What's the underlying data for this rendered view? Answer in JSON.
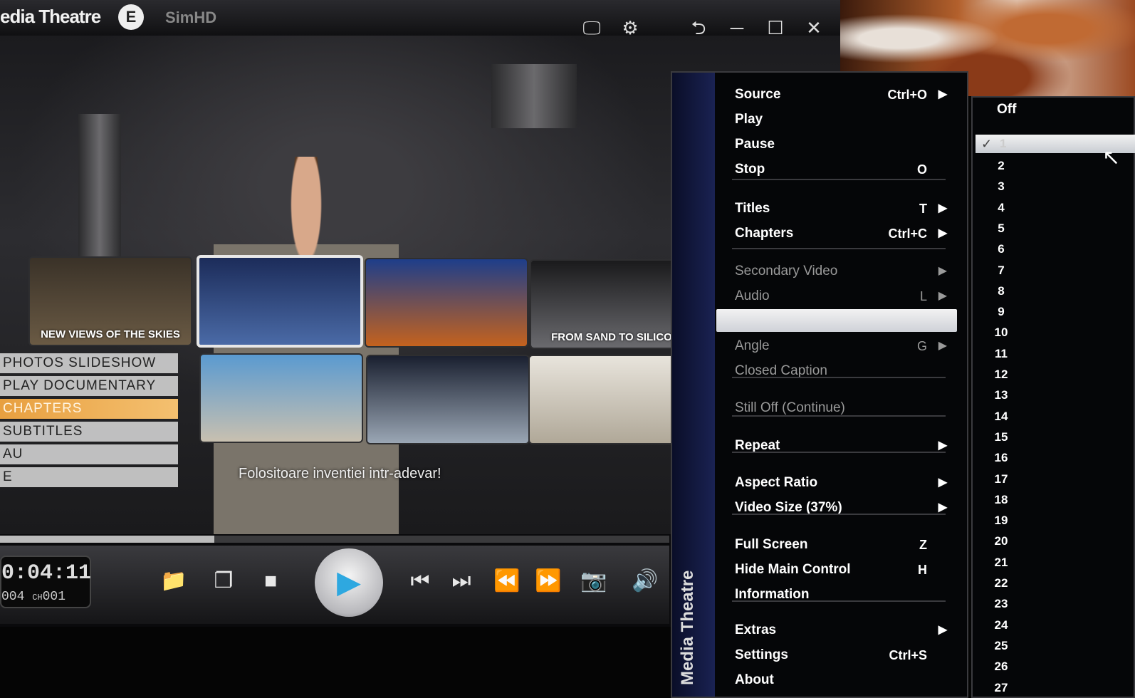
{
  "window": {
    "title": "edia Theatre",
    "badge": "E",
    "brand": "SimHD"
  },
  "disc_menu": {
    "tiles": [
      {
        "label": "NEW VIEWS OF THE SKIES"
      },
      {
        "label": ""
      },
      {
        "label": ""
      },
      {
        "label": "FROM SAND TO SILICO"
      }
    ],
    "items": [
      {
        "label": "PHOTOS SLIDESHOW",
        "highlighted": false
      },
      {
        "label": "PLAY DOCUMENTARY",
        "highlighted": false
      },
      {
        "label": "CHAPTERS",
        "highlighted": true
      },
      {
        "label": "SUBTITLES",
        "highlighted": false
      },
      {
        "label": "AU",
        "highlighted": false
      },
      {
        "label": "E",
        "highlighted": false
      }
    ],
    "subtitle": "Folositoare inventiei intr-adevar!"
  },
  "playback": {
    "time": "0:04:11",
    "title_num": "004",
    "chapter_label": "CH",
    "chapter_num": "001",
    "progress": 0.32
  },
  "context_menu": {
    "sidebar_text": "Media Theatre",
    "items": [
      {
        "label": "Source",
        "shortcut": "Ctrl+O",
        "arrow": true,
        "dim": false
      },
      {
        "label": "Play",
        "shortcut": "",
        "arrow": false,
        "dim": false
      },
      {
        "label": "Pause",
        "shortcut": "",
        "arrow": false,
        "dim": false
      },
      {
        "label": "Stop",
        "shortcut": "O",
        "arrow": false,
        "dim": false
      },
      {
        "label": "Titles",
        "shortcut": "T",
        "arrow": true,
        "dim": false
      },
      {
        "label": "Chapters",
        "shortcut": "Ctrl+C",
        "arrow": true,
        "dim": false
      },
      {
        "label": "Secondary Video",
        "shortcut": "",
        "arrow": true,
        "dim": true
      },
      {
        "label": "Audio",
        "shortcut": "L",
        "arrow": true,
        "dim": true
      },
      {
        "label": "",
        "shortcut": "",
        "arrow": false,
        "dim": false
      },
      {
        "label": "Angle",
        "shortcut": "G",
        "arrow": true,
        "dim": true
      },
      {
        "label": "Closed Caption",
        "shortcut": "",
        "arrow": false,
        "dim": true
      },
      {
        "label": "Still Off (Continue)",
        "shortcut": "",
        "arrow": false,
        "dim": true
      },
      {
        "label": "Repeat",
        "shortcut": "",
        "arrow": true,
        "dim": false
      },
      {
        "label": "Aspect Ratio",
        "shortcut": "",
        "arrow": true,
        "dim": false
      },
      {
        "label": "Video Size (37%)",
        "shortcut": "",
        "arrow": true,
        "dim": false
      },
      {
        "label": "Full Screen",
        "shortcut": "Z",
        "arrow": false,
        "dim": false
      },
      {
        "label": "Hide Main Control",
        "shortcut": "H",
        "arrow": false,
        "dim": false
      },
      {
        "label": "Information",
        "shortcut": "",
        "arrow": false,
        "dim": false
      },
      {
        "label": "Extras",
        "shortcut": "",
        "arrow": true,
        "dim": false
      },
      {
        "label": "Settings",
        "shortcut": "Ctrl+S",
        "arrow": false,
        "dim": false
      },
      {
        "label": "About",
        "shortcut": "",
        "arrow": false,
        "dim": false
      }
    ]
  },
  "submenu": {
    "off_label": "Off",
    "selected": "1",
    "numbers": [
      "2",
      "3",
      "4",
      "5",
      "6",
      "7",
      "8",
      "9",
      "10",
      "11",
      "12",
      "13",
      "14",
      "15",
      "16",
      "17",
      "18",
      "19",
      "20",
      "21",
      "22",
      "23",
      "24",
      "25",
      "26",
      "27"
    ]
  },
  "icons": {
    "snapshot": "camera-icon",
    "settings": "gear-icon",
    "pin": "pin-icon",
    "minimize": "minimize-icon",
    "maximize": "maximize-icon",
    "close": "close-icon"
  },
  "colors": {
    "accent_blue": "#2ea8e0",
    "menu_highlight": "#e8a040",
    "sidebar": "#1a2252"
  }
}
